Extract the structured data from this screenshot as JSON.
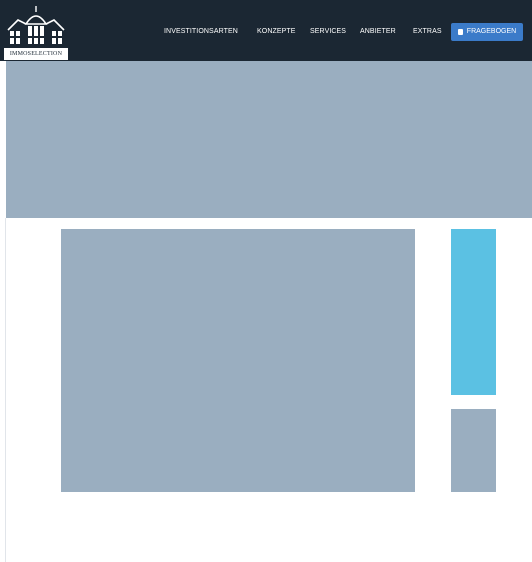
{
  "brand": {
    "logo_text": "IMMOSELECTION"
  },
  "nav": {
    "items": [
      {
        "label": "INVESTITIONSARTEN"
      },
      {
        "label": "KONZEPTE"
      },
      {
        "label": "SERVICES"
      },
      {
        "label": "ANBIETER"
      },
      {
        "label": "EXTRAS"
      }
    ],
    "cta_label": "FRAGEBOGEN",
    "cta_icon": "document-icon"
  },
  "colors": {
    "header_bg": "#1b2733",
    "placeholder": "#9aaec0",
    "accent_banner": "#5bc1e3",
    "cta_bg": "#3b7bc9"
  }
}
